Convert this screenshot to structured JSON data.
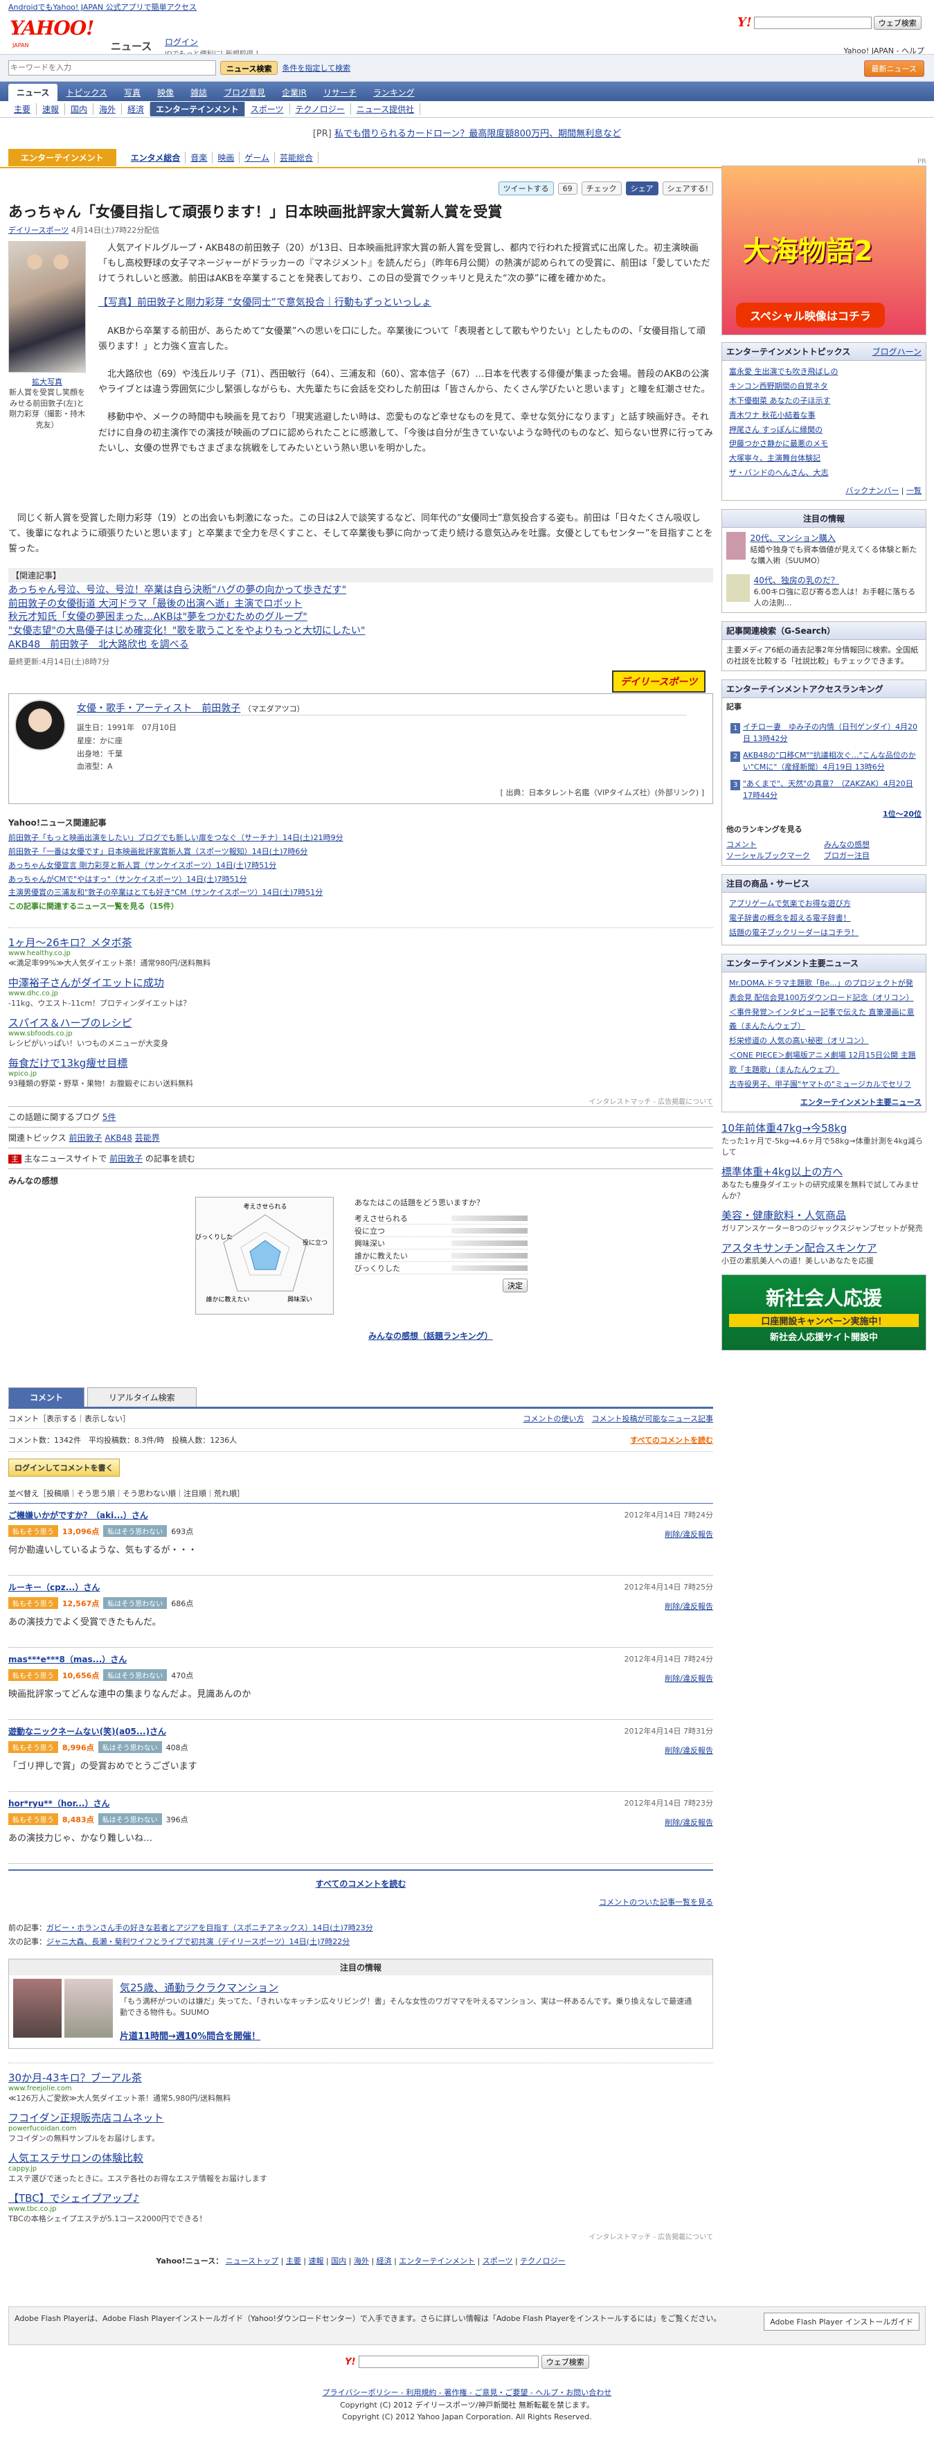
{
  "top_notice": "AndroidでもYahoo! JAPAN 公式アプリで簡単アクセス",
  "header": {
    "logo_text": "YAHOO!",
    "logo_sub": "JAPAN",
    "site_name": "ニュース",
    "login": "ログイン",
    "login_sub": "IDでもっと便利に[ 新規取得 ]",
    "search_btn": "ウェブ検索",
    "right_links": "Yahoo! JAPAN - ヘルプ"
  },
  "search": {
    "placeholder": "キーワードを入力",
    "button": "ニュース検索",
    "condition": "条件を指定して検索",
    "honbun": "最新ニュース"
  },
  "nav1": [
    "ニュース",
    "トピックス",
    "写真",
    "映像",
    "雑誌",
    "ブログ意見",
    "企業IR",
    "リサーチ",
    "ランキング"
  ],
  "nav2": [
    "主要",
    "速報",
    "国内",
    "海外",
    "経済",
    "エンターテインメント",
    "スポーツ",
    "テクノロジー",
    "ニュース提供社"
  ],
  "pr": {
    "tag": "[PR]",
    "text": "私でも借りられるカードローン？最高限度額800万円、期間無利息など"
  },
  "category": {
    "tag": "エンターテインメント",
    "items": [
      "エンタメ総合",
      "音楽",
      "映画",
      "ゲーム",
      "芸能総合"
    ]
  },
  "share": {
    "tweet": "ツイートする",
    "count": "69",
    "check": "チェック",
    "share": "シェア",
    "yahoo": "シェアする!"
  },
  "article": {
    "title": "あっちゃん「女優目指して頑張ります！」日本映画批評家大賞新人賞を受賞",
    "source": "デイリースポーツ",
    "date": "4月14日(土)7時22分配信",
    "photo_caption": "拡大写真",
    "photo_caption2": "新人賞を受賞し笑顔をみせる前田敦子(左)と剛力彩芽（撮影・持木克友）",
    "p1": "人気アイドルグループ・AKB48の前田敦子（20）が13日、日本映画批評家大賞の新人賞を受賞し、都内で行われた授賞式に出席した。初主演映画「もし高校野球の女子マネージャーがドラッカーの『マネジメント』を読んだら」（昨年6月公開）の熱演が認められての受賞に、前田は「愛していただけてうれしいと感激。前田はAKBを卒業することを発表しており、この日の受賞でクッキリと見えた“次の夢”に確を確かめた。",
    "related": "【写真】前田敦子と剛力彩芽 “女優同士”で意気投合｜行動もずっといっしょ",
    "p2": "AKBから卒業する前田が、あらためて“女優業”への思いを口にした。卒業後について「表現者として歌もやりたい」としたものの、「女優目指して頑張ります！」と力強く宣言した。",
    "p3": "北大路欣也（69）や浅丘ルリ子（71）、西田敏行（64）、三浦友和（60）、宮本信子（67）…日本を代表する俳優が集まった会場。普段のAKBの公演やライブとは違う雰囲気に少し緊張しながらも、大先輩たちに会話を交わした前田は「皆さんから、たくさん学びたいと思います」と瞳を紅潮させた。",
    "p4": "移動中や、メークの時間中も映画を見ており「現実逃避したい時は、恋愛ものなど幸せなものを見て、幸せな気分になります」と話す映画好き。それだけに自身の初主演作での演技が映画のプロに認められたことに感激して、「今後は自分が生きていないような時代のものなど、知らない世界に行ってみたいし、女優の世界でもさまざまな挑戦をしてみたいという熱い思いを明かした。",
    "p5": "同じく新人賞を受賞した剛力彩芽（19）との出会いも刺激になった。この日は2人で談笑するなど、同年代の“女優同士”意気投合する姿も。前田は「日々たくさん吸収して、後輩になれように頑張りたいと思います」と卒業まで全力を尽くすこと、そして卒業後も夢に向かって走り続ける意気込みを吐露。女優としてもセンター”を目指すことを誓った。",
    "kanren_title": "【関連記事】",
    "kanren": [
      "あっちゃん号泣、号泣、号泣！卒業は自ら決断\"ハグの夢の向かって歩きだす\"",
      "前田敦子の女優街道 大河ドラマ「最後の出演へ逝」主演でロボット",
      "秋元才知氏「女優の夢困まった…AKBは\"夢をつかむためのグループ\"",
      "\"女優志望\"の大島優子はじめ確変化！\"歌を歌うことをやよりもっと大切にしたい\"",
      "AKB48　前田敦子　北大路欣也 を調べる"
    ],
    "updated": "最終更新:4月14日(土)8時7分"
  },
  "profile": {
    "name": "女優・歌手・アーティスト　前田敦子",
    "kana": "（マエダアツコ）",
    "birth": "誕生日：1991年　07月10日",
    "sign": "星座：かに座",
    "birthplace": "出身地：千葉",
    "blood": "血液型：A",
    "ref": "[ 出典：日本タレント名鑑（VIPタイムズ社）(外部リンク) ]",
    "daily": "デイリースポーツ"
  },
  "related_news": {
    "title": "Yahoo!ニュース関連記事",
    "items": [
      "前田敦子「もっと映画出演をしたい」ブログでも新しい扉をつなぐ（サーチナ）14日(土)21時9分",
      "前田敦子「一番は女優です」日本映画批評家賞新人賞（スポーツ報知）14日(土)7時6分",
      "あっちゃん女優宣言 剛力彩芽と新人賞（サンケイスポーツ）14日(土)7時51分",
      "あっちゃんがCMで\"やはすっ\"（サンケイスポーツ）14日(土)7時51分",
      "主演男優賞の三浦友和\"敦子の卒業はとても好き\"CM（サンケイスポーツ）14日(土)7時51分"
    ],
    "more": "この記事に関連するニュース一覧を見る（15件）"
  },
  "ads": [
    {
      "t": "1ヶ月～26キロ？メタボ茶",
      "u": "www.healthy.co.jp",
      "d": "≪満足率99%≫大人気ダイエット茶！通常980円/送料無料"
    },
    {
      "t": "中澤裕子さんがダイエットに成功",
      "u": "www.dhc.co.jp",
      "d": "-11kg、ウエスト-11cm！プロティンダイエットは？"
    },
    {
      "t": "スパイス＆ハーブのレシピ",
      "u": "www.sbfoods.co.jp",
      "d": "レシピがいっぱい！いつものメニューが大変身"
    },
    {
      "t": "毎食だけで13kg痩せ目標",
      "u": "wpico.jp",
      "d": "93種類の野菜・野草・果物！お腹鍛ぞにおい送料無料"
    }
  ],
  "ads_footer": "インタレストマッチ - 広告掲載について",
  "blog": {
    "label": "この話題に関するブログ",
    "count": "5件"
  },
  "topics": {
    "label": "関連トピックス",
    "items": [
      "前田敦子",
      "AKB48",
      "芸能界"
    ]
  },
  "mainsite": {
    "label": "主なニュースサイトで",
    "name": "前田敦子",
    "tail": "の記事を読む"
  },
  "kansou": {
    "title": "みんなの感想",
    "radar_labels": [
      "考えさせられる",
      "役に立つ",
      "興味深い",
      "誰かに教えたい",
      "びっくりした"
    ],
    "vote_question": "あなたはこの話題をどう思いますか？",
    "vote_rows": [
      "考えさせられる",
      "役に立つ",
      "興味深い",
      "誰かに教えたい",
      "びっくりした"
    ],
    "decide": "決定",
    "ranking": "みんなの感想（話題ランキング）"
  },
  "comments": {
    "tab1": "コメント",
    "tab2": "リアルタイム検索",
    "display_opts": "コメント［表示する｜表示しない］",
    "usage": "コメントの使い方",
    "list_link": "コメント投稿が可能なニュース記事",
    "stat": "コメント数：1342件　平均投稿数：8.3件/時　投稿人数：1236人",
    "all_link": "すべてのコメントを読む",
    "login": "ログインしてコメントを書く",
    "sort": "並べ替え［投稿順｜そう思う順｜そう思わない順｜注目順｜荒れ順］",
    "good_label": "私もそう思う",
    "bad_label": "私はそう思わない",
    "delete": "削除/違反報告",
    "items": [
      {
        "user": "ご機嫌いかがですか？（aki...）さん",
        "date": "2012年4月14日 7時24分",
        "good": "13,096点",
        "bad": "693点",
        "text": "何か勘違いしているような、気もするが・・・"
      },
      {
        "user": "ルーキー（cpz...）さん",
        "date": "2012年4月14日 7時25分",
        "good": "12,567点",
        "bad": "686点",
        "text": "あの演技力でよく受賞できたもんだ。"
      },
      {
        "user": "mas***e***8（mas...）さん",
        "date": "2012年4月14日 7時24分",
        "good": "10,656点",
        "bad": "470点",
        "text": "映画批評家ってどんな連中の集まりなんだよ。見識あんのか"
      },
      {
        "user": "遊動なニックネームない(笑)(a05...)さん",
        "date": "2012年4月14日 7時31分",
        "good": "8,996点",
        "bad": "408点",
        "text": "「ゴリ押しで賞」の受賞おめでとうございます"
      },
      {
        "user": "hor*ryu**（hor...）さん",
        "date": "2012年4月14日 7時23分",
        "good": "8,483点",
        "bad": "396点",
        "text": "あの演技力じゃ、かなり難しいね…"
      }
    ],
    "all_bottom": "すべてのコメントを読む",
    "commented_list": "コメントのついた記事一覧を見る"
  },
  "prevnext": {
    "prev_label": "前の記事：",
    "prev": "ガビー・ホランさん手の好きな若者とアジアを目指す（スポニチアネックス）14日(土)7時23分",
    "next_label": "次の記事：",
    "next": "ジャニ大森、長瀬・菊利ワイフとライブで初共演（デイリースポーツ）14日(土)7時22分"
  },
  "chumoku": {
    "title": "注目の情報",
    "headline": "気25歳、通勤ラクラクマンション",
    "desc": "「もう満杯がついのは嫌だ」失ってた、「きれいなキッチン広々リビング！書」そんな女性のワガママを叶えるマンション、実は一杯あるんです。乗り換えなしで最速通勤できる物件も。SUUMO",
    "link": "片道11時間→週10%問合を開催！"
  },
  "ads2": [
    {
      "t": "30か月-43キロ？ブーアル茶",
      "u": "www.freejolie.com",
      "d": "≪126万人ご愛飲≫大人気ダイエット茶！通常5,980円/送料無料"
    },
    {
      "t": "フコイダン正規販売店コムネット",
      "u": "powerfucoidan.com",
      "d": "フコイダンの無料サンプルをお届けします。"
    },
    {
      "t": "人気エステサロンの体験比較",
      "u": "cappy.jp",
      "d": "エステ選びで迷ったときに。エステ各社のお得なエステ情報をお届けします"
    },
    {
      "t": "【TBC】でシェイプアップ♪",
      "u": "www.tbc.co.jp",
      "d": "TBCの本格シェイプエステが5.1コース2000円でできる！"
    }
  ],
  "footnav": [
    "Yahoo!ニュース：",
    "ニューストップ",
    "主要",
    "速報",
    "国内",
    "海外",
    "経済",
    "エンターテインメント",
    "スポーツ",
    "テクノロジー"
  ],
  "flash": {
    "text": "Adobe Flash Playerは、Adobe Flash Playerインストールガイド（Yahoo!ダウンロードセンター）で入手できます。さらに詳しい情報は「Adobe Flash Playerをインストールするには」をご覧ください。",
    "btn": "Adobe Flash Player インストールガイド"
  },
  "bottom": {
    "search_btn": "ウェブ検索",
    "links": "プライバシーポリシー - 利用規約 - 著作権 - ご意見・ご要望 - ヘルプ・お問い合わせ",
    "copy1": "Copyright (C) 2012 デイリースポーツ/神戸新聞社 無断転載を禁じます。",
    "copy2": "Copyright (C) 2012 Yahoo Japan Corporation. All Rights Reserved."
  },
  "side": {
    "pr_label": "PR",
    "banner_title": "大海物語2",
    "banner_cta": "スペシャル映像はコチラ",
    "topics_title": "エンターテインメントトピックス",
    "topics_right": "ブログハーン",
    "topics": [
      "富永愛 生出演でも吹き飛ばしの",
      "キンコン西野期間の自覚ネタ",
      "木下優樹菜 あなたの子ほ示す",
      "青木ワナ 秋花小結着な事",
      "押尾さん すっぽんに縁関の",
      "伊藤つかさ静かに最悪のメモ",
      "大塚寧々、主演舞台体験記",
      "ザ・バンドのへんさん、大志"
    ],
    "topics_back": "バックナンバー",
    "topics_list": "一覧",
    "attention_title": "注目の情報",
    "attention": [
      {
        "t": "20代、マンション購入",
        "d": "結婚や独身でも資本価値が見えてくる体験と新たな購入術（SUUMO）"
      },
      {
        "t": "40代、独房の乳のだ？",
        "d": "6.00キロ強に忍び寄る恋人は！お手軽に落ちる人の法則…"
      }
    ],
    "gsearch_title": "記事関連検索（G-Search）",
    "gsearch_text": "主要メディア6紙の過去記事2年分情報回に検索。全国紙の社説を比較する「社説比較」もテェックできます。",
    "ranking_title": "エンターテインメントアクセスランキング",
    "ranking_sub": "記事",
    "ranking": [
      "イチロー妻　ゆみ子の内情（日刊ゲンダイ）4月20日 13時42分",
      "AKB48の\"口移CM\"\"抗議相次ぐ…\"こんな品位のかい\"CMに\"（産経新聞）4月19日 13時6分",
      "\"あくまで\"、天然\"の真意？（ZAKZAK）4月20日 17時44分"
    ],
    "ranking_more": "1位～20位",
    "other_ranking": "他のランキングを見る",
    "other": [
      "コメント",
      "みんなの感想",
      "ソーシャルブックマーク",
      "ブロガー注目"
    ],
    "svc_title": "注目の商品・サービス",
    "svc": [
      "アプリゲームで気楽でお得な遊び方",
      "電子辞書の概念を超える電子辞書！",
      "話題の電子ブックリーダーはコチラ！"
    ],
    "main_title": "エンターテインメント主要ニュース",
    "main_news": [
      "Mr.DOMA.ドラマ主題歌「Be...」のプロジェクトが発表会見 配信会見100万ダウンロード記念（オリコン）",
      "＜事件発覚＞インタビュー記事で伝えた 直筆漫画に意義（まんたんウェブ）",
      "杉栄修道の 人気の高い秘密（オリコン）",
      "＜ONE PIECE＞劇場版アニメ劇場 12月15日公開 主題歌「主題歌」（まんたんウェブ）",
      "古寺役男子、甲子園\"ヤマトの\"ミュージカルでセリフ"
    ],
    "main_more": "エンターテインメント主要ニュース",
    "ad": [
      {
        "t": "10年前体重47kg→今58kg",
        "d": "たった1ヶ月で-5kg→4.6ヶ月で58kg→体重計測を4kg減らして"
      },
      {
        "t": "標準体重+4kg以上の方へ",
        "d": "あなたも痩身ダイエットの研究成果を無料で試してみませんか？"
      },
      {
        "t": "美容・健康飲料・人気商品",
        "d": "ガリアンスケーター8つのジャックスジャンプセットが発売"
      },
      {
        "t": "アスタキサンチン配合スキンケア",
        "d": "小豆の素肌美人への道！美しいあなたを応援"
      }
    ],
    "shinsha_a": "新社会人応援",
    "shinsha_b": "口座開設キャンペーン実施中！",
    "shinsha_c": "新社会人応援サイト開設中"
  }
}
